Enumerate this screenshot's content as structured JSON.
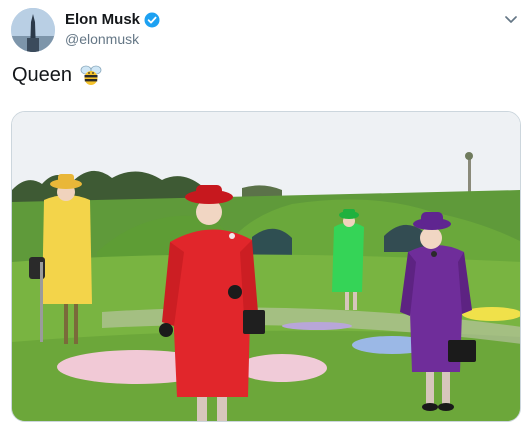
{
  "author": {
    "display_name": "Elon Musk",
    "handle": "@elonmusk",
    "avatar_icon": "profile-photo",
    "verified_icon": "verified-badge-icon",
    "verified_color": "#1da1f2"
  },
  "tweet": {
    "text": "Queen",
    "emoji_icon": "bee-emoji-icon"
  },
  "menu": {
    "icon": "chevron-down-icon"
  },
  "media": {
    "description_icon": "photo",
    "figures": [
      {
        "name": "figure-yellow",
        "color": "#f3d44a"
      },
      {
        "name": "figure-red",
        "color": "#e1262b"
      },
      {
        "name": "figure-green",
        "color": "#35d457"
      },
      {
        "name": "figure-purple",
        "color": "#6f2d9a"
      }
    ]
  },
  "colors": {
    "text_primary": "#14171a",
    "text_secondary": "#657786",
    "border": "#ccd6dd"
  }
}
